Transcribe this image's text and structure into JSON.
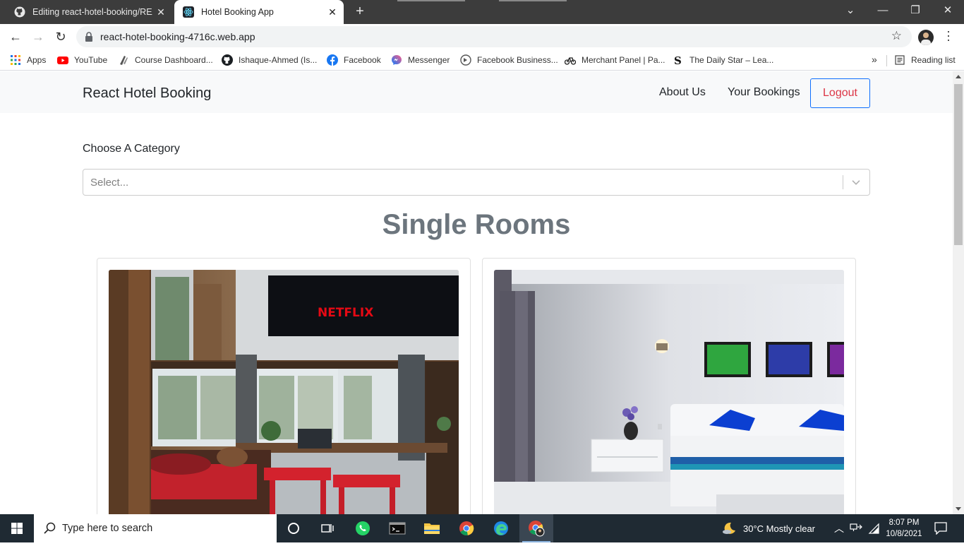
{
  "browser": {
    "tabs": [
      {
        "title": "Editing react-hotel-booking/README",
        "icon": "github-icon",
        "active": false
      },
      {
        "title": "Hotel Booking App",
        "icon": "react-icon",
        "active": true
      }
    ],
    "url": "react-hotel-booking-4716c.web.app",
    "bookmarks": [
      {
        "label": "Apps",
        "icon": "apps-grid-icon"
      },
      {
        "label": "YouTube",
        "icon": "youtube-icon"
      },
      {
        "label": "Course Dashboard...",
        "icon": "course-icon"
      },
      {
        "label": "Ishaque-Ahmed (Is...",
        "icon": "github-icon"
      },
      {
        "label": "Facebook",
        "icon": "facebook-icon"
      },
      {
        "label": "Messenger",
        "icon": "messenger-icon"
      },
      {
        "label": "Facebook Business...",
        "icon": "business-icon"
      },
      {
        "label": "Merchant Panel | Pa...",
        "icon": "bicycle-icon"
      },
      {
        "label": "The Daily Star – Lea...",
        "icon": "daily-star-icon"
      }
    ],
    "more_bookmarks": "»",
    "reading_list": "Reading list"
  },
  "app": {
    "brand": "React Hotel Booking",
    "nav": {
      "about": "About Us",
      "bookings": "Your Bookings",
      "logout": "Logout"
    },
    "category_label": "Choose A Category",
    "select_placeholder": "Select...",
    "section_title": "Single Rooms",
    "rooms": [
      {
        "image": "cabin-room-with-netflix-tv",
        "sign_text": "NETFLIX"
      },
      {
        "image": "white-bedroom-with-blue-pillows"
      }
    ]
  },
  "taskbar": {
    "search_placeholder": "Type here to search",
    "weather": "30°C  Mostly clear",
    "time": "8:07 PM",
    "date": "10/8/2021"
  },
  "colors": {
    "logout_border": "#0d6efd",
    "logout_text": "#dc3545",
    "section_title": "#6c757d",
    "navbar_bg": "#f8f9fa"
  }
}
